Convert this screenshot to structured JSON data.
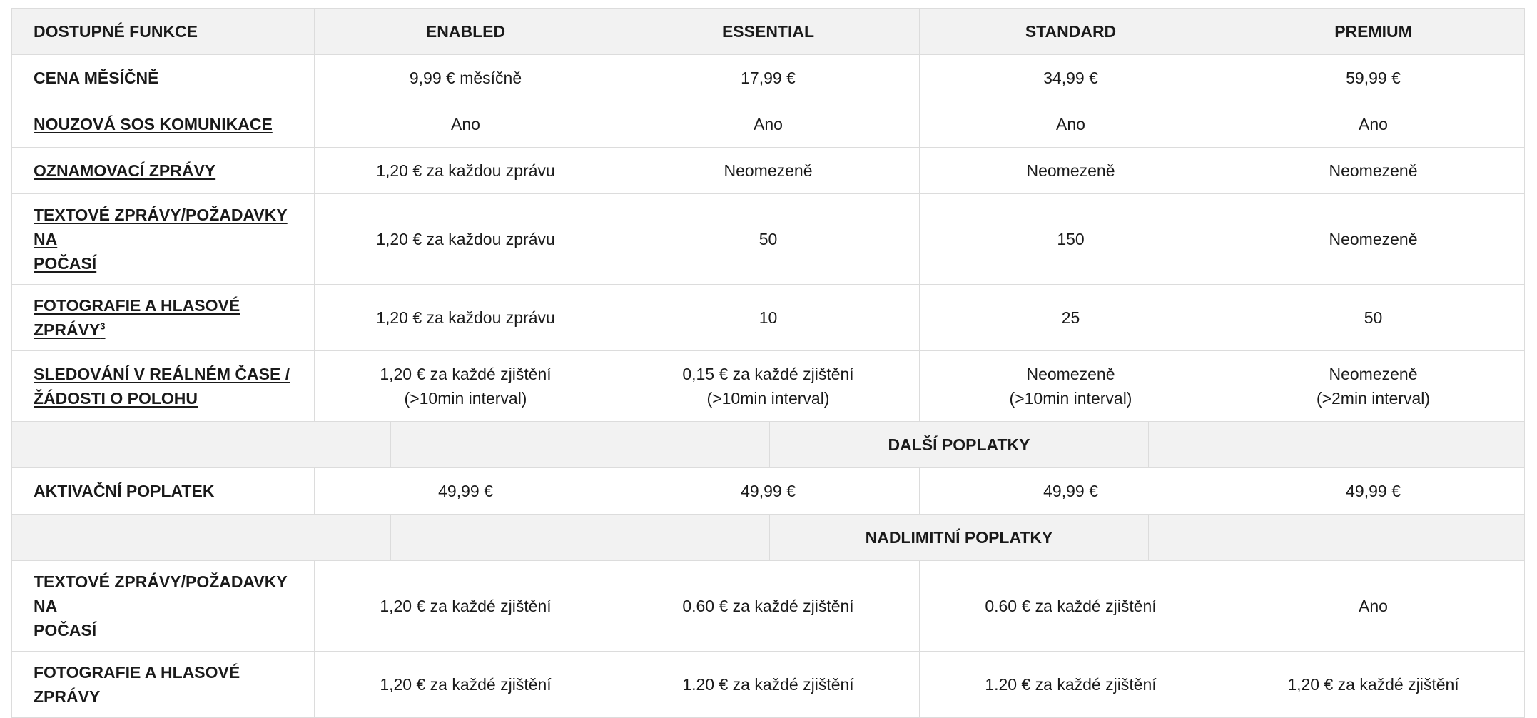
{
  "header": {
    "label": "DOSTUPNÉ FUNKCE",
    "plans": [
      "ENABLED",
      "ESSENTIAL",
      "STANDARD",
      "PREMIUM"
    ]
  },
  "rows": [
    {
      "label": "CENA MĚSÍČNĚ",
      "values": [
        "9,99 € měsíčně",
        "17,99 €",
        "34,99 €",
        "59,99 €"
      ]
    },
    {
      "label": "NOUZOVÁ SOS KOMUNIKACE",
      "values": [
        "Ano",
        "Ano",
        "Ano",
        "Ano"
      ]
    },
    {
      "label": "OZNAMOVACÍ ZPRÁVY",
      "values": [
        "1,20 € za každou zprávu",
        "Neomezeně",
        "Neomezeně",
        "Neomezeně"
      ]
    },
    {
      "label_line1": "TEXTOVÉ ZPRÁVY/POŽADAVKY NA",
      "label_line2": "POČASÍ",
      "values": [
        "1,20 € za každou zprávu",
        "50",
        "150",
        "Neomezeně"
      ]
    },
    {
      "label": "FOTOGRAFIE A HLASOVÉ ZPRÁVY",
      "label_sup": "3",
      "values": [
        "1,20 € za každou zprávu",
        "10",
        "25",
        "50"
      ]
    },
    {
      "label_line1": "SLEDOVÁNÍ V REÁLNÉM ČASE /",
      "label_line2": "ŽÁDOSTI O POLOHU",
      "values_line1": [
        "1,20 € za každé zjištění",
        "0,15 € za každé zjištění",
        "Neomezeně",
        "Neomezeně"
      ],
      "values_line2": [
        "(>10min interval)",
        "(>10min interval)",
        "(>10min interval)",
        "(>2min interval)"
      ]
    }
  ],
  "section_additional": {
    "title": "DALŠÍ POPLATKY",
    "rows": [
      {
        "label": "AKTIVAČNÍ POPLATEK",
        "values": [
          "49,99 €",
          "49,99 €",
          "49,99 €",
          "49,99 €"
        ]
      }
    ]
  },
  "section_overage": {
    "title": "NADLIMITNÍ POPLATKY",
    "rows": [
      {
        "label_line1": "TEXTOVÉ ZPRÁVY/POŽADAVKY NA",
        "label_line2": "POČASÍ",
        "values": [
          "1,20 € za každé zjištění",
          "0.60 € za každé zjištění",
          "0.60 € za každé zjištění",
          "Ano"
        ]
      },
      {
        "label": "FOTOGRAFIE A HLASOVÉ ZPRÁVY",
        "values": [
          "1,20 € za každé zjištění",
          "1.20 € za každé zjištění",
          "1.20 € za každé zjištění",
          "1,20 € za každé zjištění"
        ]
      }
    ]
  },
  "colors": {
    "header_bg": "#f2f2f2",
    "border": "#dcdcdc",
    "text": "#1a1a1a"
  }
}
